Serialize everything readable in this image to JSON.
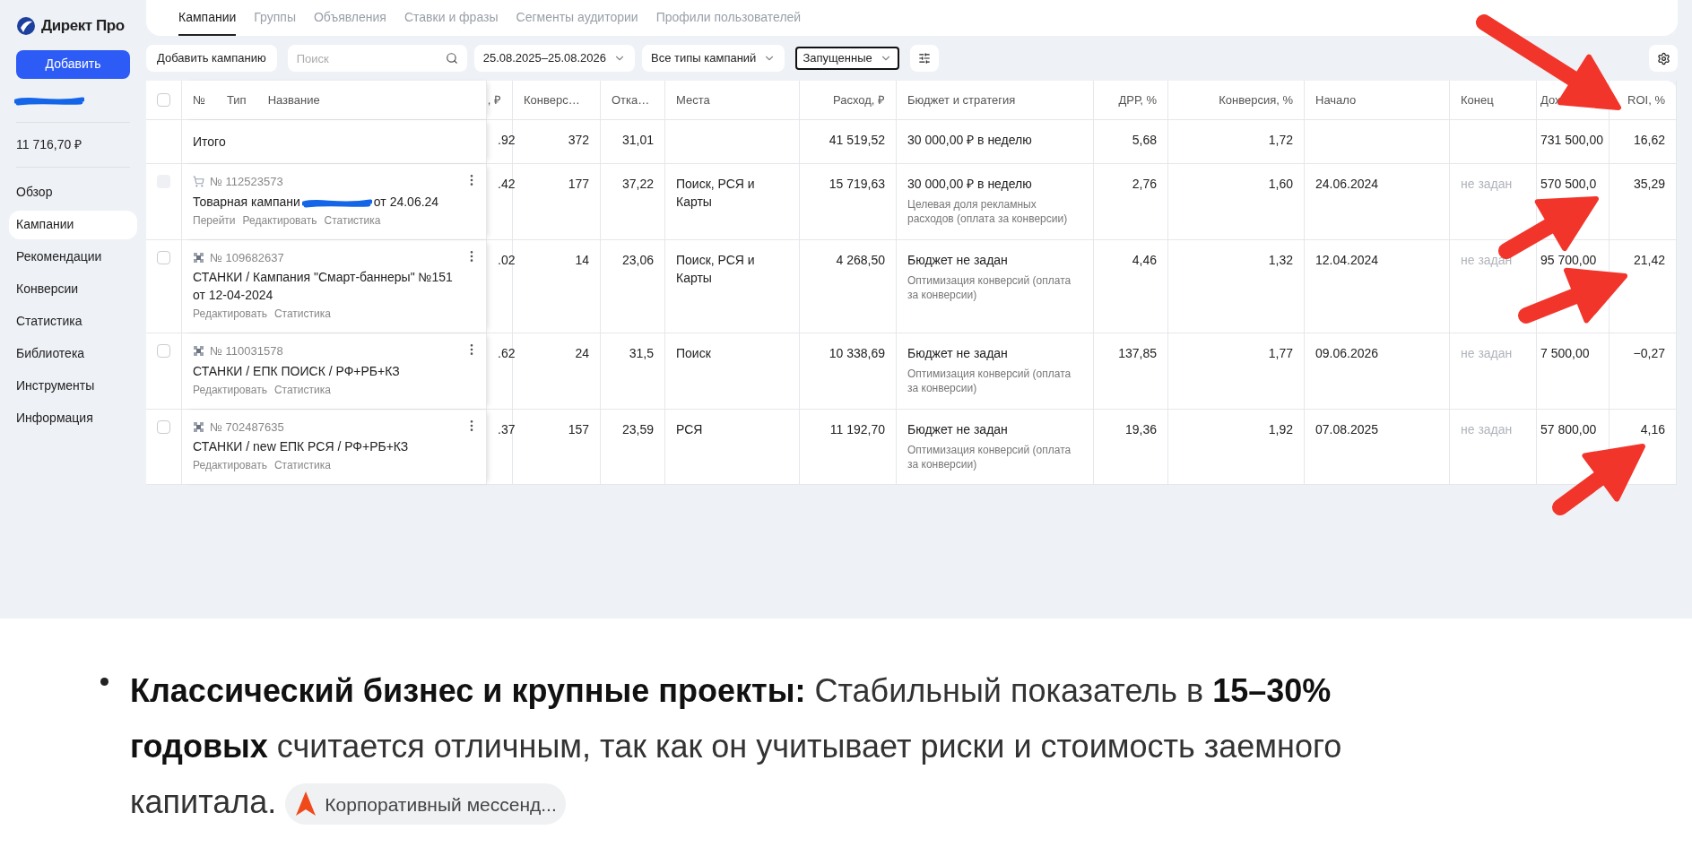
{
  "sidebar": {
    "logo": "Директ Про",
    "add_button": "Добавить",
    "balance": "11 716,70 ₽",
    "nav": [
      {
        "label": "Обзор",
        "selected": false
      },
      {
        "label": "Кампании",
        "selected": true
      },
      {
        "label": "Рекомендации",
        "selected": false
      },
      {
        "label": "Конверсии",
        "selected": false
      },
      {
        "label": "Статистика",
        "selected": false
      },
      {
        "label": "Библиотека",
        "selected": false
      },
      {
        "label": "Инструменты",
        "selected": false
      },
      {
        "label": "Информация",
        "selected": false
      }
    ]
  },
  "tabs": [
    {
      "label": "Кампании",
      "selected": true
    },
    {
      "label": "Группы",
      "selected": false
    },
    {
      "label": "Объявления",
      "selected": false
    },
    {
      "label": "Ставки и фразы",
      "selected": false
    },
    {
      "label": "Сегменты аудитории",
      "selected": false
    },
    {
      "label": "Профили пользователей",
      "selected": false
    }
  ],
  "toolbar": {
    "add_campaign": "Добавить кампанию",
    "search": {
      "placeholder": "Поиск"
    },
    "date_range": "25.08.2025–25.08.2026",
    "type_filter": "Все типы кампаний",
    "status_filter": "Запущенные"
  },
  "table": {
    "name_headers": [
      "№",
      "Тип",
      "Название"
    ],
    "columns": [
      {
        "label": ", ₽",
        "kind": "number"
      },
      {
        "label": "Конверс…",
        "kind": "count"
      },
      {
        "label": "Отка…",
        "kind": "count"
      },
      {
        "label": "Места",
        "kind": "text"
      },
      {
        "label": "Расход, ₽",
        "kind": "number"
      },
      {
        "label": "Бюджет и стратегия",
        "kind": "text"
      },
      {
        "label": "ДРР, %",
        "kind": "number"
      },
      {
        "label": "Конверсия, %",
        "kind": "number"
      },
      {
        "label": "Начало",
        "kind": "text"
      },
      {
        "label": "Конец",
        "kind": "text"
      },
      {
        "label": "Дох",
        "kind": "text"
      },
      {
        "label": "ROI, %",
        "kind": "number"
      }
    ],
    "select_all": {
      "checked": false
    },
    "total": {
      "label": "Итого",
      "cells": [
        ".92",
        "372",
        "31,01",
        null,
        "41 519,52",
        {
          "main": "30 000,00 ₽ в неделю"
        },
        "5,68",
        "1,72",
        null,
        null,
        "731 500,00",
        "16,62"
      ]
    },
    "rows": [
      {
        "kind": "cart",
        "number": "№ 112523573",
        "name": [
          "Товарная кампани",
          "от 24.06.24"
        ],
        "disabled": true,
        "links": [
          "Перейти",
          "Редактировать",
          "Статистика"
        ],
        "cells": [
          ".42",
          "177",
          "37,22",
          "Поиск, РСЯ и Карты",
          "15 719,63",
          {
            "main": "30 000,00 ₽ в неделю",
            "note": "Целевая доля рекламных расходов (оплата за конверсии)"
          },
          "2,76",
          "1,60",
          "24.06.2024",
          {
            "muted": "не задан"
          },
          "570 500,0",
          "35,29"
        ]
      },
      {
        "kind": "grid",
        "number": "№ 109682637",
        "name": [
          "СТАНКИ / Кампания \"Смарт-баннеры\" №151 от 12-04-2024"
        ],
        "disabled": false,
        "links": [
          "Редактировать",
          "Статистика"
        ],
        "cells": [
          ".02",
          "14",
          "23,06",
          "Поиск, РСЯ и Карты",
          "4 268,50",
          {
            "main": "Бюджет не задан",
            "note": "Оптимизация конверсий (оплата за конверсии)"
          },
          "4,46",
          "1,32",
          "12.04.2024",
          {
            "muted": "не задан"
          },
          "95 700,00",
          "21,42"
        ]
      },
      {
        "kind": "grid",
        "number": "№ 110031578",
        "name": [
          "СТАНКИ / ЕПК ПОИСК / РФ+РБ+КЗ"
        ],
        "disabled": false,
        "links": [
          "Редактировать",
          "Статистика"
        ],
        "cells": [
          ".62",
          "24",
          "31,5",
          "Поиск",
          "10 338,69",
          {
            "main": "Бюджет не задан",
            "note": "Оптимизация конверсий (оплата за конверсии)"
          },
          "137,85",
          "1,77",
          "09.06.2026",
          {
            "muted": "не задан"
          },
          "7 500,00",
          "−0,27"
        ]
      },
      {
        "kind": "grid",
        "number": "№ 702487635",
        "name": [
          "СТАНКИ / new ЕПК РСЯ / РФ+РБ+КЗ"
        ],
        "disabled": false,
        "links": [
          "Редактировать",
          "Статистика"
        ],
        "cells": [
          ".37",
          "157",
          "23,59",
          "РСЯ",
          "11 192,70",
          {
            "main": "Бюджет не задан",
            "note": "Оптимизация конверсий (оплата за конверсии)"
          },
          "19,36",
          "1,92",
          "07.08.2025",
          {
            "muted": "не задан"
          },
          "57 800,00",
          "4,16"
        ]
      }
    ]
  },
  "snippet": {
    "text": "**Классический бизнес и крупные проекты:** Стабильный показатель в **15–30% годовых** считается отличным, так как он учитывает риски и стоимость заемного капитала.",
    "source_chip": "Корпоративный мессенд..."
  }
}
